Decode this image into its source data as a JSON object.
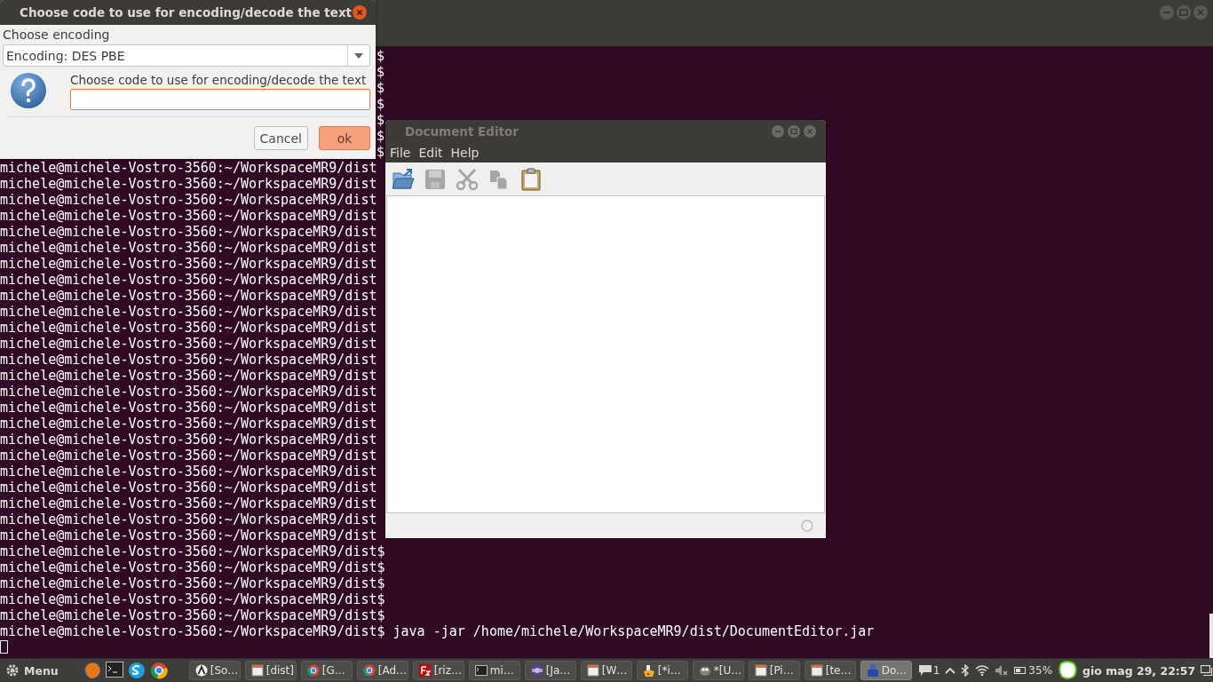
{
  "terminal": {
    "lines": [
      {
        "kind": "tail",
        "text": "$"
      },
      {
        "kind": "tail",
        "text": "$"
      },
      {
        "kind": "tail",
        "text": "$"
      },
      {
        "kind": "tail",
        "text": "$"
      },
      {
        "kind": "tail",
        "text": "$"
      },
      {
        "kind": "tail",
        "text": "$"
      },
      {
        "kind": "tail",
        "text": "$"
      },
      {
        "kind": "full",
        "text": "michele@michele-Vostro-3560:~/WorkspaceMR9/dist"
      },
      {
        "kind": "full",
        "text": "michele@michele-Vostro-3560:~/WorkspaceMR9/dist"
      },
      {
        "kind": "full",
        "text": "michele@michele-Vostro-3560:~/WorkspaceMR9/dist"
      },
      {
        "kind": "full",
        "text": "michele@michele-Vostro-3560:~/WorkspaceMR9/dist"
      },
      {
        "kind": "full",
        "text": "michele@michele-Vostro-3560:~/WorkspaceMR9/dist"
      },
      {
        "kind": "full",
        "text": "michele@michele-Vostro-3560:~/WorkspaceMR9/dist"
      },
      {
        "kind": "full",
        "text": "michele@michele-Vostro-3560:~/WorkspaceMR9/dist"
      },
      {
        "kind": "full",
        "text": "michele@michele-Vostro-3560:~/WorkspaceMR9/dist"
      },
      {
        "kind": "full",
        "text": "michele@michele-Vostro-3560:~/WorkspaceMR9/dist"
      },
      {
        "kind": "full",
        "text": "michele@michele-Vostro-3560:~/WorkspaceMR9/dist"
      },
      {
        "kind": "full",
        "text": "michele@michele-Vostro-3560:~/WorkspaceMR9/dist"
      },
      {
        "kind": "full",
        "text": "michele@michele-Vostro-3560:~/WorkspaceMR9/dist"
      },
      {
        "kind": "full",
        "text": "michele@michele-Vostro-3560:~/WorkspaceMR9/dist"
      },
      {
        "kind": "full",
        "text": "michele@michele-Vostro-3560:~/WorkspaceMR9/dist"
      },
      {
        "kind": "full",
        "text": "michele@michele-Vostro-3560:~/WorkspaceMR9/dist"
      },
      {
        "kind": "full",
        "text": "michele@michele-Vostro-3560:~/WorkspaceMR9/dist"
      },
      {
        "kind": "full",
        "text": "michele@michele-Vostro-3560:~/WorkspaceMR9/dist"
      },
      {
        "kind": "full",
        "text": "michele@michele-Vostro-3560:~/WorkspaceMR9/dist"
      },
      {
        "kind": "full",
        "text": "michele@michele-Vostro-3560:~/WorkspaceMR9/dist"
      },
      {
        "kind": "full",
        "text": "michele@michele-Vostro-3560:~/WorkspaceMR9/dist"
      },
      {
        "kind": "full",
        "text": "michele@michele-Vostro-3560:~/WorkspaceMR9/dist"
      },
      {
        "kind": "full",
        "text": "michele@michele-Vostro-3560:~/WorkspaceMR9/dist"
      },
      {
        "kind": "full",
        "text": "michele@michele-Vostro-3560:~/WorkspaceMR9/dist"
      },
      {
        "kind": "full",
        "text": "michele@michele-Vostro-3560:~/WorkspaceMR9/dist"
      },
      {
        "kind": "full",
        "text": "michele@michele-Vostro-3560:~/WorkspaceMR9/dist$"
      },
      {
        "kind": "full",
        "text": "michele@michele-Vostro-3560:~/WorkspaceMR9/dist$"
      },
      {
        "kind": "full",
        "text": "michele@michele-Vostro-3560:~/WorkspaceMR9/dist$"
      },
      {
        "kind": "full",
        "text": "michele@michele-Vostro-3560:~/WorkspaceMR9/dist$"
      },
      {
        "kind": "full",
        "text": "michele@michele-Vostro-3560:~/WorkspaceMR9/dist$"
      },
      {
        "kind": "full",
        "text": "michele@michele-Vostro-3560:~/WorkspaceMR9/dist$ java -jar /home/michele/WorkspaceMR9/dist/DocumentEditor.jar"
      }
    ]
  },
  "dialog": {
    "title": "Choose code to use for encoding/decode the text",
    "combo_label": "Choose encoding",
    "combo_value": "Encoding: DES PBE",
    "prompt": "Choose code to use for encoding/decode the text",
    "buttons": [
      {
        "label": "Cancel",
        "default": false
      },
      {
        "label": "ok",
        "default": true
      }
    ]
  },
  "editor": {
    "title": "Document Editor",
    "menu": [
      "File",
      "Edit",
      "Help"
    ],
    "toolbar": [
      {
        "kind": "open",
        "disabled": false
      },
      {
        "kind": "save",
        "disabled": true
      },
      {
        "kind": "cut",
        "disabled": true
      },
      {
        "kind": "copy",
        "disabled": true
      },
      {
        "kind": "paste",
        "disabled": false
      }
    ]
  },
  "taskbar": {
    "menu_label": "Menu",
    "tasks": [
      {
        "kind": "app",
        "label": "[So…",
        "selected": false
      },
      {
        "kind": "folder",
        "label": "[dist]",
        "selected": false
      },
      {
        "kind": "browser",
        "label": "[G…",
        "selected": false
      },
      {
        "kind": "browser",
        "label": "[Ad…",
        "selected": false
      },
      {
        "kind": "ftp",
        "label": "[riz…",
        "selected": false
      },
      {
        "kind": "terminal",
        "label": "mi…",
        "selected": false
      },
      {
        "kind": "ide",
        "label": "[Ja…",
        "selected": false
      },
      {
        "kind": "folder",
        "label": "[W…",
        "selected": false
      },
      {
        "kind": "paint",
        "label": "[*i…",
        "selected": false
      },
      {
        "kind": "gimp",
        "label": "*[U…",
        "selected": false
      },
      {
        "kind": "folder",
        "label": "[Pi…",
        "selected": false
      },
      {
        "kind": "folder",
        "label": "[te…",
        "selected": false
      },
      {
        "kind": "java",
        "label": "Do…",
        "selected": true
      }
    ],
    "notifications": "1",
    "battery": "35%",
    "clock": "gio mag 29, 22:57"
  }
}
